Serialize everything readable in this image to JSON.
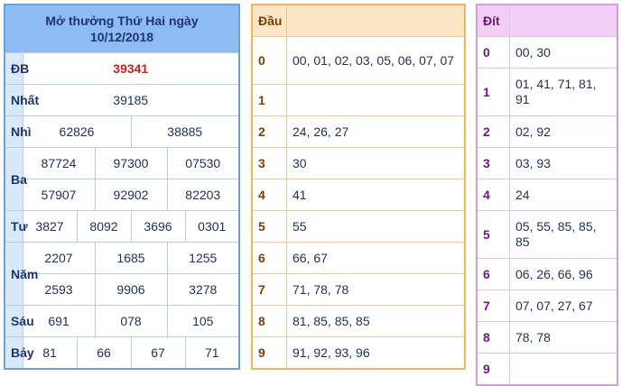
{
  "results": {
    "title": "Mở thưởng Thứ Hai ngày",
    "date": "10/12/2018",
    "rows": {
      "db": {
        "label": "ĐB",
        "values": [
          "39341"
        ]
      },
      "nhat": {
        "label": "Nhất",
        "values": [
          "39185"
        ]
      },
      "nhi": {
        "label": "Nhì",
        "values": [
          "62826",
          "38885"
        ]
      },
      "ba": {
        "label": "Ba",
        "values": [
          "87724",
          "97300",
          "07530",
          "57907",
          "92902",
          "82203"
        ]
      },
      "tu": {
        "label": "Tư",
        "values": [
          "3827",
          "8092",
          "3696",
          "0301"
        ]
      },
      "nam": {
        "label": "Năm",
        "values": [
          "2207",
          "1685",
          "1255",
          "2593",
          "9906",
          "3278"
        ]
      },
      "sau": {
        "label": "Sáu",
        "values": [
          "691",
          "078",
          "105"
        ]
      },
      "bay": {
        "label": "Bảy",
        "values": [
          "81",
          "66",
          "67",
          "71"
        ]
      }
    }
  },
  "dau": {
    "header": "Đầu",
    "rows": [
      {
        "key": "0",
        "value": "00, 01, 02, 03, 05, 06, 07, 07"
      },
      {
        "key": "1",
        "value": ""
      },
      {
        "key": "2",
        "value": "24, 26, 27"
      },
      {
        "key": "3",
        "value": "30"
      },
      {
        "key": "4",
        "value": "41"
      },
      {
        "key": "5",
        "value": "55"
      },
      {
        "key": "6",
        "value": "66, 67"
      },
      {
        "key": "7",
        "value": "71, 78, 78"
      },
      {
        "key": "8",
        "value": "81, 85, 85, 85"
      },
      {
        "key": "9",
        "value": "91, 92, 93, 96"
      }
    ]
  },
  "dit": {
    "header": "Đít",
    "rows": [
      {
        "key": "0",
        "value": "00, 30"
      },
      {
        "key": "1",
        "value": "01, 41, 71, 81, 91"
      },
      {
        "key": "2",
        "value": "02, 92"
      },
      {
        "key": "3",
        "value": "03, 93"
      },
      {
        "key": "4",
        "value": "24"
      },
      {
        "key": "5",
        "value": "05, 55, 85, 85, 85"
      },
      {
        "key": "6",
        "value": "06, 26, 66, 96"
      },
      {
        "key": "7",
        "value": "07, 07, 27, 67"
      },
      {
        "key": "8",
        "value": "78, 78"
      },
      {
        "key": "9",
        "value": ""
      }
    ]
  }
}
